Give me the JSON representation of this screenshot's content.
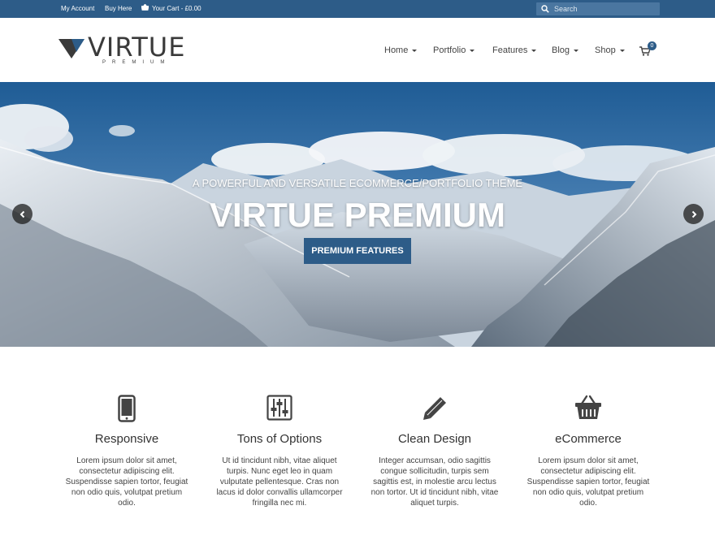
{
  "topbar": {
    "my_account": "My Account",
    "buy_here": "Buy Here",
    "cart": "Your Cart - £0.00",
    "search_placeholder": "Search"
  },
  "logo": {
    "word": "VIRTUE",
    "sub": "PREMIUM"
  },
  "nav": {
    "items": [
      {
        "label": "Home"
      },
      {
        "label": "Portfolio"
      },
      {
        "label": "Features"
      },
      {
        "label": "Blog"
      },
      {
        "label": "Shop"
      }
    ],
    "cart_count": "0"
  },
  "hero": {
    "tagline": "A POWERFUL AND VERSATILE ECOMMERCE/PORTFOLIO THEME",
    "title": "VIRTUE PREMIUM",
    "button": "PREMIUM FEATURES"
  },
  "features": [
    {
      "icon": "mobile-phone-icon",
      "title": "Responsive",
      "text": "Lorem ipsum dolor sit amet, consectetur adipiscing elit. Suspendisse sapien tortor, feugiat non odio quis, volutpat pretium odio."
    },
    {
      "icon": "sliders-icon",
      "title": "Tons of Options",
      "text": "Ut id tincidunt nibh, vitae aliquet turpis. Nunc eget leo in quam vulputate pellentesque. Cras non lacus id dolor convallis ullamcorper fringilla nec mi."
    },
    {
      "icon": "pencil-icon",
      "title": "Clean Design",
      "text": "Integer accumsan, odio sagittis congue sollicitudin, turpis sem sagittis est, in molestie arcu lectus non tortor. Ut id tincidunt nibh, vitae aliquet turpis."
    },
    {
      "icon": "shopping-basket-icon",
      "title": "eCommerce",
      "text": "Lorem ipsum dolor sit amet, consectetur adipiscing elit. Suspendisse sapien tortor, feugiat non odio quis, volutpat pretium odio."
    }
  ],
  "colors": {
    "accent": "#2d5c88",
    "topbar": "#2d5c88",
    "text": "#444444"
  }
}
